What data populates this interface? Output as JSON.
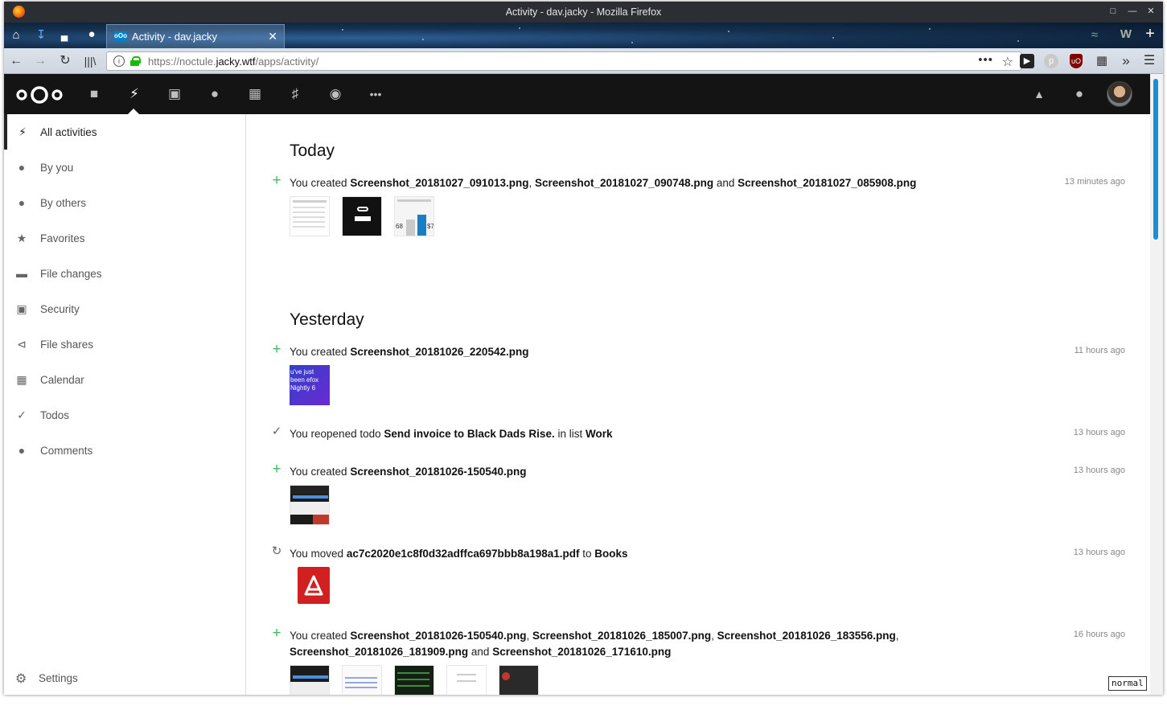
{
  "window": {
    "title": "Activity - dav.jacky - Mozilla Firefox"
  },
  "browser": {
    "tab_title": "Activity - dav.jacky",
    "url_host_prefix": "https://noctule.",
    "url_host": "jacky.wtf",
    "url_path": "/apps/activity/",
    "page_action_dots": "•••"
  },
  "nextcloud": {
    "header_icons": [
      "files-icon",
      "activity-icon",
      "gallery-icon",
      "contacts-icon",
      "calendar-icon",
      "audio-icon",
      "maps-icon",
      "more-icon"
    ],
    "sidebar": {
      "items": [
        {
          "label": "All activities",
          "icon": "lightning-icon"
        },
        {
          "label": "By you",
          "icon": "user-icon"
        },
        {
          "label": "By others",
          "icon": "users-icon"
        },
        {
          "label": "Favorites",
          "icon": "star-icon"
        },
        {
          "label": "File changes",
          "icon": "folder-icon"
        },
        {
          "label": "Security",
          "icon": "lock-icon"
        },
        {
          "label": "File shares",
          "icon": "share-icon"
        },
        {
          "label": "Calendar",
          "icon": "calendar-icon"
        },
        {
          "label": "Todos",
          "icon": "check-icon"
        },
        {
          "label": "Comments",
          "icon": "comment-icon"
        }
      ],
      "settings_label": "Settings"
    },
    "sections": {
      "today": "Today",
      "yesterday": "Yesterday"
    },
    "activities": [
      {
        "prefix": "You created ",
        "files": [
          "Screenshot_20181027_091013.png",
          ", ",
          "Screenshot_20181027_090748.png",
          " and ",
          "Screenshot_20181027_085908.png"
        ],
        "time": "13 minutes ago"
      },
      {
        "prefix": "You created ",
        "file": "Screenshot_20181026_220542.png",
        "time": "11 hours ago",
        "thumb_text": "u've just been efox Nightly 6"
      },
      {
        "prefix": "You reopened todo ",
        "todo": "Send invoice to Black Dads Rise.",
        "middle": " in list ",
        "list": "Work",
        "time": "13 hours ago"
      },
      {
        "prefix": "You created ",
        "file": "Screenshot_20181026-150540.png",
        "time": "13 hours ago"
      },
      {
        "prefix": "You moved ",
        "file": "ac7c2020e1c8f0d32adffca697bbb8a198a1.pdf",
        "middle": " to ",
        "target": "Books",
        "time": "13 hours ago"
      },
      {
        "prefix": "You created ",
        "f1": "Screenshot_20181026-150540.png",
        "f2": "Screenshot_20181026_185007.png",
        "f3": "Screenshot_20181026_183556.png",
        "f4": "Screenshot_20181026_181909.png",
        "and": " and ",
        "f5": "Screenshot_20181026_171610.png",
        "time": "16 hours ago"
      }
    ],
    "thumb_chart_labels": [
      "68",
      "$7"
    ]
  },
  "mode_badge": "normal",
  "colors": {
    "accent_blue": "#0082c9",
    "add_green": "#46ba61",
    "header_bg": "#141414"
  }
}
